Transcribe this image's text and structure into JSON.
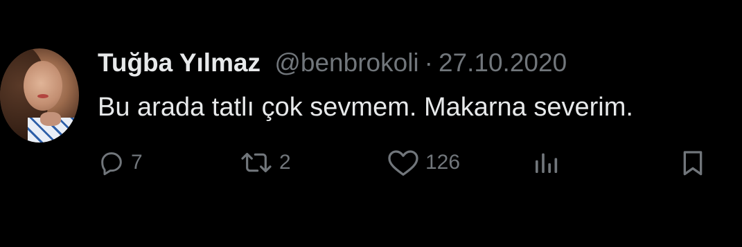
{
  "tweet": {
    "author_name": "Tuğba Yılmaz",
    "handle": "@benbrokoli",
    "separator": "·",
    "date": "27.10.2020",
    "text": "Bu arada tatlı çok sevmem. Makarna severim."
  },
  "actions": {
    "replies": "7",
    "retweets": "2",
    "likes": "126"
  },
  "icons": {
    "reply": "reply-icon",
    "retweet": "retweet-icon",
    "like": "heart-icon",
    "views": "views-icon",
    "bookmark": "bookmark-icon"
  },
  "colors": {
    "background": "#000000",
    "primary_text": "#e7e9ea",
    "secondary_text": "#71767b"
  }
}
